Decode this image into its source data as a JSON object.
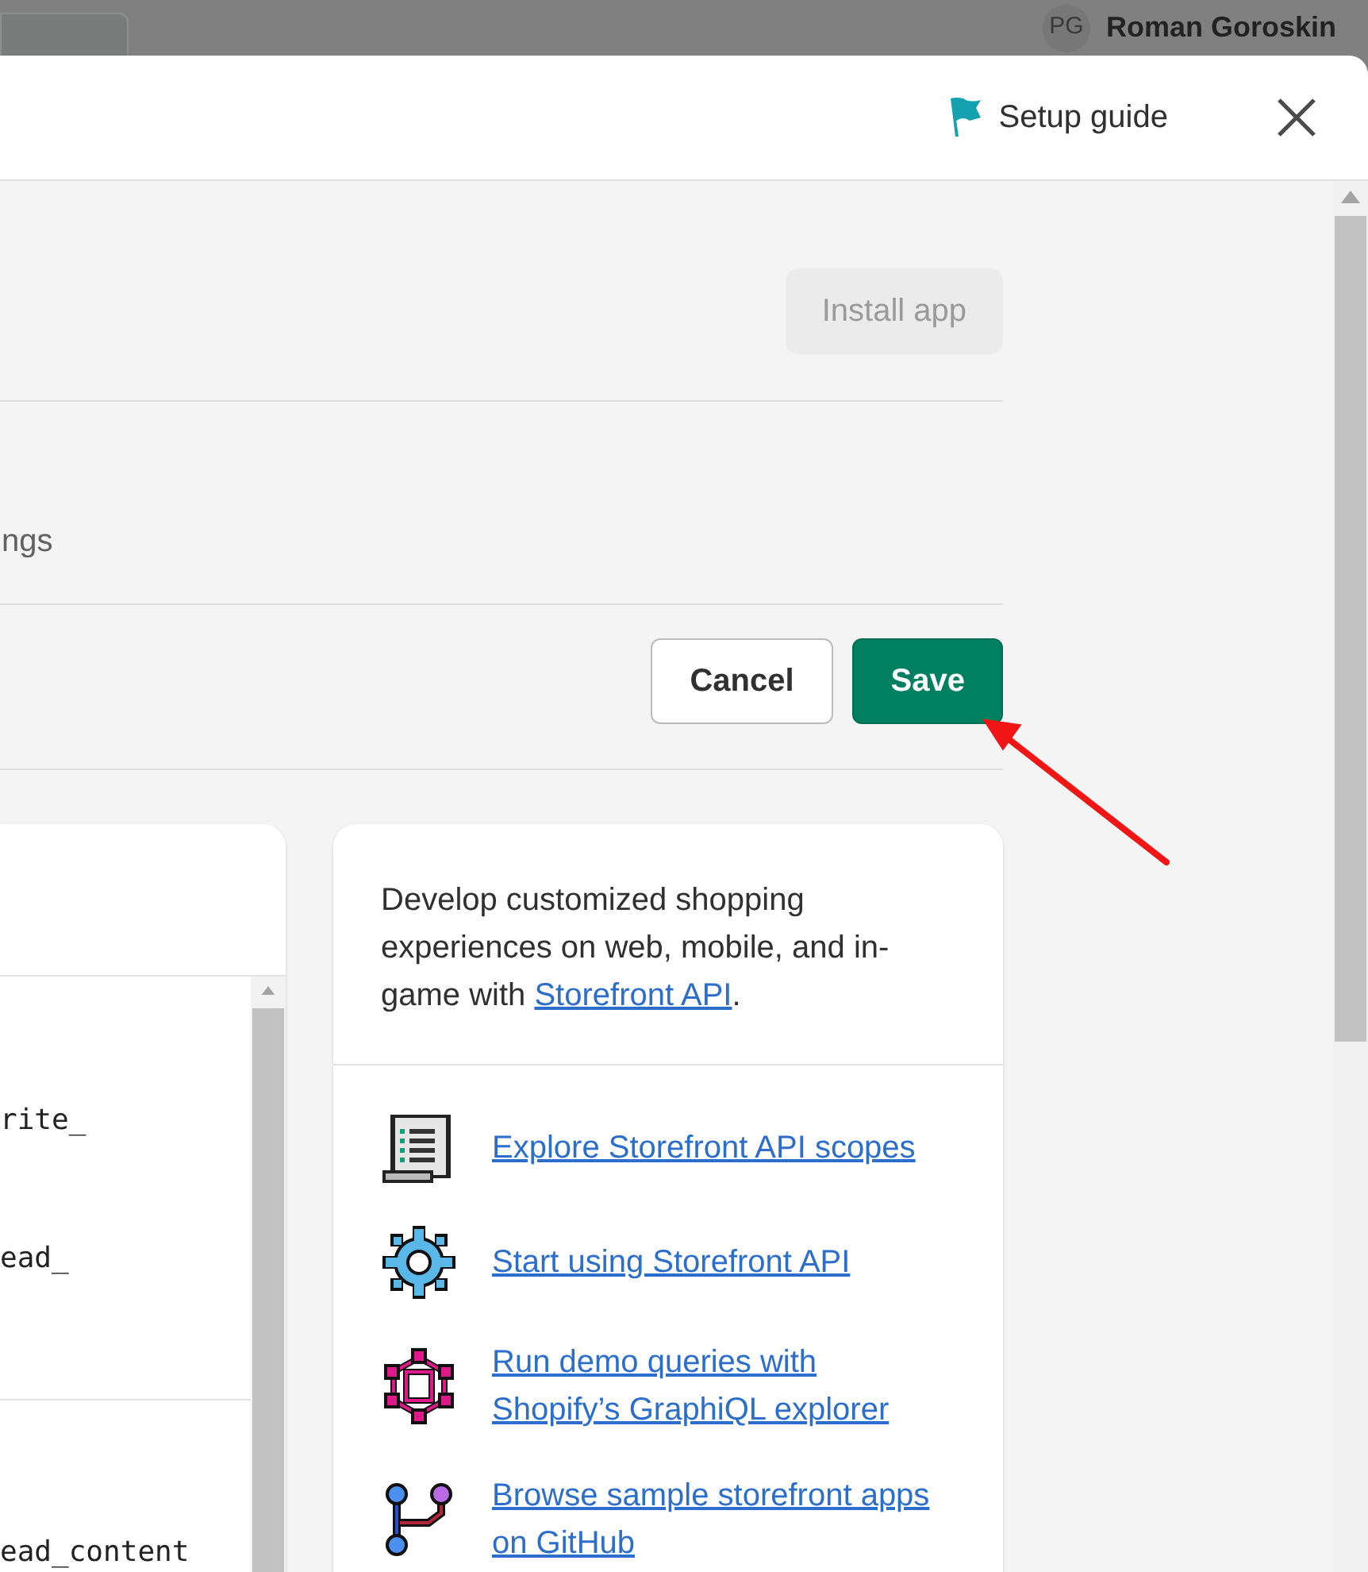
{
  "backdrop": {
    "avatar": "PG",
    "user_name": "Roman Goroskin"
  },
  "header": {
    "setup_guide": "Setup guide"
  },
  "install_button": {
    "label": "Install app",
    "disabled": true
  },
  "tab": {
    "label": "ngs"
  },
  "actions": [
    {
      "label": "Cancel",
      "kind": "secondary"
    },
    {
      "label": "Save",
      "kind": "primary"
    }
  ],
  "scopes_panel": {
    "groups": [
      [
        "rite_",
        "ead_"
      ],
      [
        "ead_content"
      ]
    ]
  },
  "storefront_card": {
    "description": "Develop customized shopping experiences on web, mobile, and in-game with ",
    "description_link": "Storefront API",
    "description_end": ".",
    "links": [
      {
        "label": "Explore Storefront API scopes"
      },
      {
        "label": "Start using Storefront API"
      },
      {
        "label": "Run demo queries with Shopify’s GraphiQL explorer"
      },
      {
        "label": "Browse sample storefront apps on GitHub"
      }
    ]
  }
}
